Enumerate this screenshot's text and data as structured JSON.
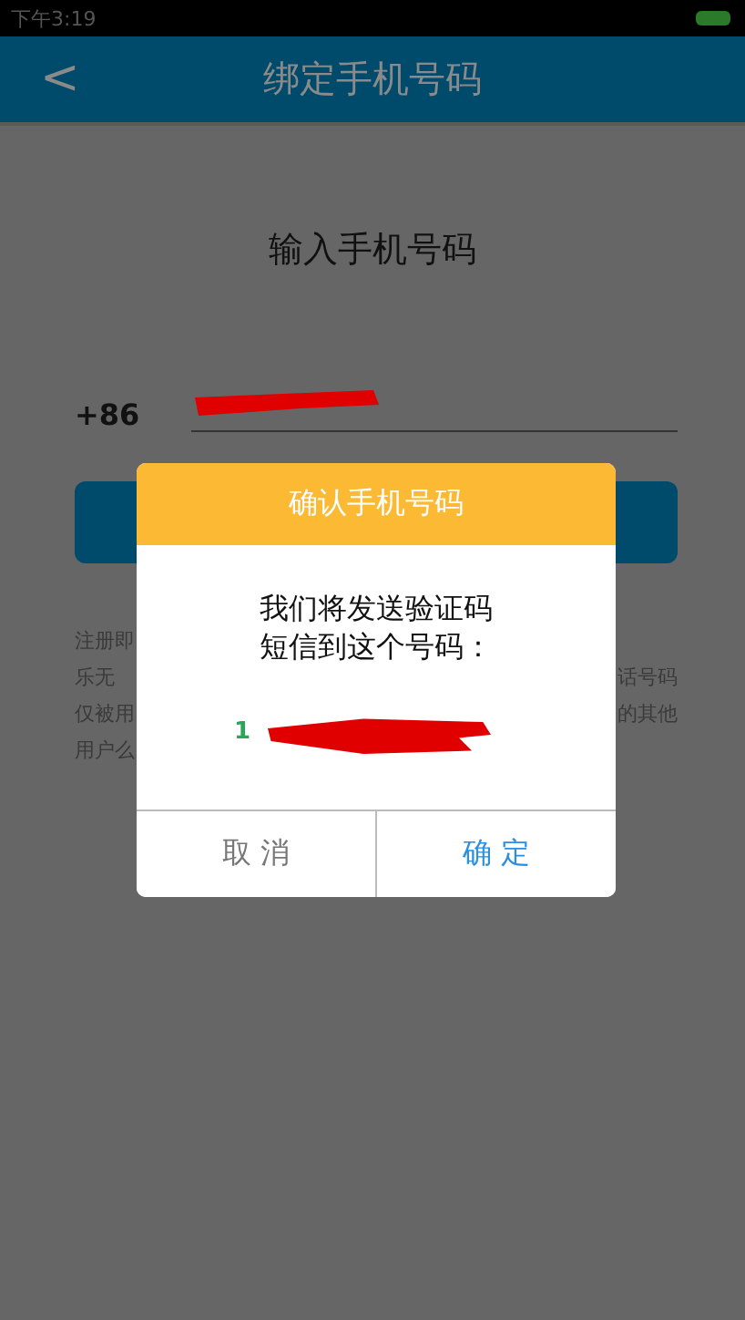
{
  "status_bar": {
    "time": "下午3:19"
  },
  "header": {
    "back": "<",
    "title": "绑定手机号码"
  },
  "page": {
    "heading": "输入手机号码",
    "country_code": "+86",
    "note_lines": [
      {
        "left": "注册即"
      },
      {
        "left": "乐无",
        "right": "话号码"
      },
      {
        "left": "仅被用",
        "right": "的其他"
      },
      {
        "left": "用户么"
      }
    ]
  },
  "dialog": {
    "title": "确认手机号码",
    "message_lines": [
      "我们将发送验证码",
      "短信到这个号码："
    ],
    "number_visible": "1",
    "buttons": [
      {
        "label": "取 消",
        "kind": "cancel"
      },
      {
        "label": "确 定",
        "kind": "confirm"
      }
    ]
  }
}
